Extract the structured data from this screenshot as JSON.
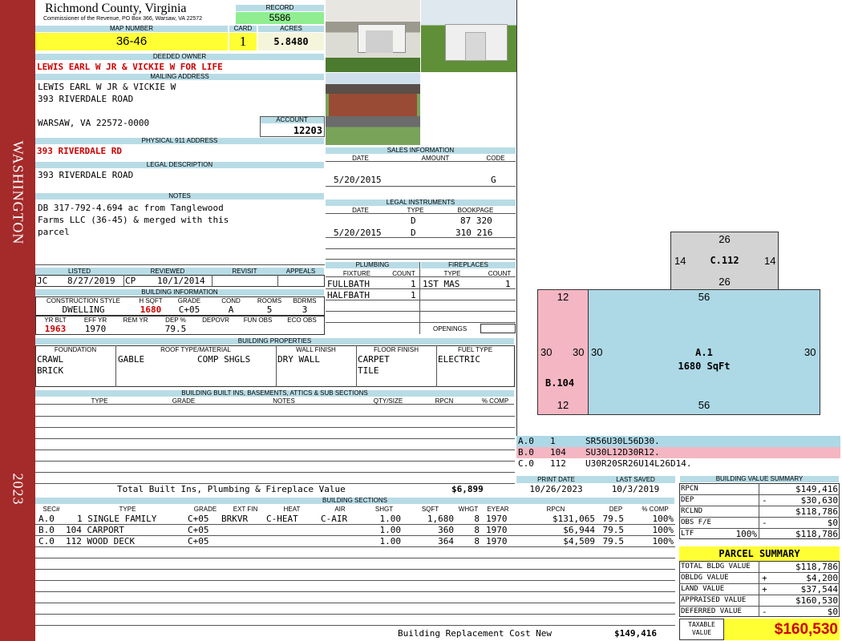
{
  "sidebar": {
    "vertical_text": "WASHINGTON",
    "year": "2023"
  },
  "header": {
    "county": "Richmond County, Virginia",
    "commissioner": "Commissioner of the Revenue, PO Box 366, Warsaw, VA 22572",
    "record_label": "RECORD",
    "record": "5586"
  },
  "parcel": {
    "map_label": "MAP NUMBER",
    "map": "36-46",
    "card_label": "CARD",
    "card": "1",
    "acres_label": "ACRES",
    "acres": "5.8480"
  },
  "owner": {
    "label": "DEEDED OWNER",
    "name": "LEWIS EARL W JR & VICKIE W FOR LIFE"
  },
  "mailing": {
    "label": "MAILING ADDRESS",
    "line1": "LEWIS EARL W JR & VICKIE W",
    "line2": "393 RIVERDALE ROAD",
    "line3": "WARSAW, VA 22572-0000"
  },
  "account": {
    "label": "ACCOUNT",
    "value": "12203"
  },
  "physical": {
    "label": "PHYSICAL 911 ADDRESS",
    "value": "393 RIVERDALE RD"
  },
  "legal": {
    "label": "LEGAL DESCRIPTION",
    "value": "393 RIVERDALE ROAD"
  },
  "notes": {
    "label": "NOTES",
    "line1": "DB 317-792-4.694 ac from Tanglewood",
    "line2": "Farms LLC (36-45) & merged with this",
    "line3": "parcel"
  },
  "sales": {
    "title": "SALES INFORMATION",
    "date_h": "DATE",
    "amount_h": "AMOUNT",
    "code_h": "CODE",
    "date": "5/20/2015",
    "amount": "",
    "code": "G"
  },
  "instruments": {
    "title": "LEGAL INSTRUMENTS",
    "date_h": "DATE",
    "type_h": "TYPE",
    "book_h": "BOOKPAGE",
    "rows": [
      {
        "date": "",
        "type": "D",
        "book": "87 320"
      },
      {
        "date": "5/20/2015",
        "type": "D",
        "book": "310 216"
      }
    ]
  },
  "plumbing": {
    "title": "PLUMBING",
    "fixture_h": "FIXTURE",
    "count_h": "COUNT",
    "rows": [
      {
        "fixture": "FULLBATH",
        "count": "1"
      },
      {
        "fixture": "HALFBATH",
        "count": "1"
      }
    ]
  },
  "fireplaces": {
    "title": "FIREPLACES",
    "type_h": "TYPE",
    "count_h": "COUNT",
    "type": "1ST MAS",
    "count": "1",
    "openings_label": "OPENINGS"
  },
  "review": {
    "listed_h": "LISTED",
    "reviewed_h": "REVIEWED",
    "revisit_h": "REVISIT",
    "appeals_h": "APPEALS",
    "listed_by": "JC",
    "listed": "8/27/2019",
    "reviewed_by": "CP",
    "reviewed": "10/1/2014"
  },
  "bldg_info": {
    "title": "BUILDING INFORMATION",
    "cs_h": "CONSTRUCTION STYLE",
    "hsqft_h": "H SQFT",
    "grade_h": "GRADE",
    "cond_h": "COND",
    "rooms_h": "ROOMS",
    "bdrms_h": "BDRMS",
    "cs": "DWELLING",
    "hsqft": "1680",
    "grade": "C+05",
    "cond": "A",
    "rooms": "5",
    "bdrms": "3",
    "yrblt_h": "YR BLT",
    "effyr_h": "EFF YR",
    "remyr_h": "REM YR",
    "dep_h": "DEP %",
    "depovr_h": "DEPOVR",
    "funobs_h": "FUN OBS",
    "ecoobs_h": "ECO OBS",
    "yrblt": "1963",
    "effyr": "1970",
    "dep": "79.5"
  },
  "bldg_props": {
    "title": "BUILDING PROPERTIES",
    "foundation_h": "FOUNDATION",
    "roof_h": "ROOF TYPE/MATERIAL",
    "wall_h": "WALL FINISH",
    "floor_h": "FLOOR FINISH",
    "fuel_h": "FUEL TYPE",
    "foundation1": "CRAWL",
    "foundation2": "BRICK",
    "roof1": "GABLE",
    "roof2": "COMP SHGLS",
    "wall": "DRY WALL",
    "floor1": "CARPET",
    "floor2": "TILE",
    "fuel": "ELECTRIC"
  },
  "builtins": {
    "title": "BUILDING BUILT INS, BASEMENTS, ATTICS & SUB SECTIONS",
    "type_h": "TYPE",
    "grade_h": "GRADE",
    "notes_h": "NOTES",
    "qty_h": "QTY/SIZE",
    "rpcn_h": "RPCN",
    "comp_h": "% COMP",
    "total_label": "Total Built Ins, Plumbing & Fireplace Value",
    "total": "$6,899"
  },
  "sketch": {
    "c_top": "26",
    "c_left": "14",
    "c_label": "C.112",
    "c_right": "14",
    "c_bottom": "26",
    "b_top": "12",
    "b_left": "30",
    "b_right": "30",
    "b_label": "B.104",
    "b_bottom": "12",
    "a_top": "56",
    "a_left": "30",
    "a_label": "A.1",
    "a_area": "1680 SqFt",
    "a_right": "30",
    "a_bottom": "56",
    "colors": {
      "a": "#add8e6",
      "b": "#f4b6c2",
      "c": "#d3d3d3"
    },
    "legend": [
      {
        "sec": "A.0",
        "code": "1",
        "path": "SR56U30L56D30."
      },
      {
        "sec": "B.0",
        "code": "104",
        "path": "SU30L12D30R12."
      },
      {
        "sec": "C.0",
        "code": "112",
        "path": "U30R20SR26U14L26D14."
      }
    ]
  },
  "print": {
    "print_h": "PRINT DATE",
    "saved_h": "LAST SAVED",
    "print": "10/26/2023",
    "saved": "10/3/2019"
  },
  "sections": {
    "title": "BUILDING SECTIONS",
    "headers": [
      "SEC#",
      "TYPE",
      "GRADE",
      "EXT FIN",
      "HEAT",
      "AIR",
      "SHGT",
      "SQFT",
      "WHGT",
      "EYEAR",
      "RPCN",
      "DEP",
      "% COMP"
    ],
    "rows": [
      {
        "sec": "A.0",
        "type": "1 SINGLE FAMILY",
        "grade": "C+05",
        "ext": "BRKVR",
        "heat": "C-HEAT",
        "air": "C-AIR",
        "shgt": "1.00",
        "sqft": "1,680",
        "whgt": "8",
        "eyear": "1970",
        "rpcn": "$131,065",
        "dep": "79.5",
        "comp": "100%"
      },
      {
        "sec": "B.0",
        "type": "104 CARPORT",
        "grade": "C+05",
        "ext": "",
        "heat": "",
        "air": "",
        "shgt": "1.00",
        "sqft": "360",
        "whgt": "8",
        "eyear": "1970",
        "rpcn": "$6,944",
        "dep": "79.5",
        "comp": "100%"
      },
      {
        "sec": "C.0",
        "type": "112 WOOD DECK",
        "grade": "C+05",
        "ext": "",
        "heat": "",
        "air": "",
        "shgt": "1.00",
        "sqft": "364",
        "whgt": "8",
        "eyear": "1970",
        "rpcn": "$4,509",
        "dep": "79.5",
        "comp": "100%"
      }
    ],
    "replacement_label": "Building Replacement Cost New",
    "replacement": "$149,416"
  },
  "value_summary": {
    "title": "BUILDING VALUE SUMMARY",
    "rows": [
      {
        "label": "RPCN",
        "sign": "",
        "value": "$149,416"
      },
      {
        "label": "DEP",
        "sign": "-",
        "value": "$30,630"
      },
      {
        "label": "RCLND",
        "sign": "",
        "value": "$118,786"
      },
      {
        "label": "OBS F/E",
        "sign": "-",
        "value": "$0"
      },
      {
        "label": "LTF",
        "sign": "100%",
        "value": "$118,786"
      }
    ]
  },
  "parcel_summary": {
    "title": "PARCEL SUMMARY",
    "rows": [
      {
        "label": "TOTAL BLDG VALUE",
        "sign": "",
        "value": "$118,786"
      },
      {
        "label": "OBLDG VALUE",
        "sign": "+",
        "value": "$4,200"
      },
      {
        "label": "LAND VALUE",
        "sign": "+",
        "value": "$37,544"
      },
      {
        "label": "APPRAISED VALUE",
        "sign": "",
        "value": "$160,530"
      },
      {
        "label": "DEFERRED VALUE",
        "sign": "-",
        "value": "$0"
      }
    ],
    "taxable_label1": "TAXABLE",
    "taxable_label2": "VALUE",
    "taxable": "$160,530"
  },
  "photos": [
    "garage-and-carport-photo",
    "storage-shed-photo",
    "brick-house-photo"
  ]
}
